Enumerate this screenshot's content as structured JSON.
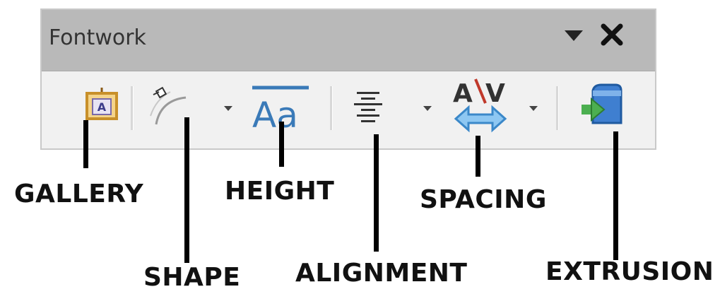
{
  "panel": {
    "title": "Fontwork",
    "menu_icon": "dropdown-triangle-icon",
    "close_icon": "close-icon"
  },
  "tools": [
    {
      "name": "gallery",
      "icon": "fontwork-gallery-icon"
    },
    {
      "name": "shape",
      "icon": "fontwork-shape-icon",
      "has_dropdown": true
    },
    {
      "name": "height",
      "icon": "same-letter-heights-icon"
    },
    {
      "name": "alignment",
      "icon": "align-center-icon",
      "has_dropdown": true
    },
    {
      "name": "spacing",
      "icon": "character-spacing-icon",
      "has_dropdown": true
    },
    {
      "name": "extrusion",
      "icon": "toggle-extrusion-icon"
    }
  ],
  "callouts": {
    "gallery": "GALLERY",
    "shape": "SHAPE",
    "height": "HEIGHT",
    "alignment": "ALIGNMENT",
    "spacing": "SPACING",
    "extrusion": "EXTRUSION"
  },
  "colors": {
    "titlebar": "#b9b9b9",
    "toolbar_bg": "#f1f1f1",
    "gallery_frame": "#c8902a",
    "height_blue": "#3a7ab8",
    "spacing_red": "#c0392b",
    "spacing_arrow": "#6aaee8",
    "extrusion_blue": "#3f7fd0",
    "extrusion_green": "#4caf50"
  }
}
